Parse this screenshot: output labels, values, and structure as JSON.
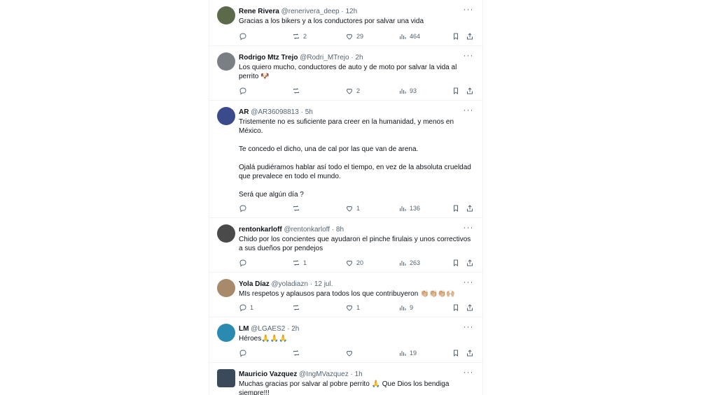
{
  "tweets": [
    {
      "name": "Rene Rivera",
      "handle": "@renerivera_deep",
      "time": "12h",
      "text": "Gracias a los bikers y a los conductores por salvar una vida",
      "replies": "",
      "retweets": "2",
      "likes": "29",
      "views": "464",
      "avatar_color": "#5a6a4a"
    },
    {
      "name": "Rodrigo Mtz Trejo",
      "handle": "@Rodri_MTrejo",
      "time": "2h",
      "text": "Los quiero mucho, conductores de auto y de moto por salvar la vida al perrito 🐶",
      "replies": "",
      "retweets": "",
      "likes": "2",
      "views": "93",
      "avatar_color": "#7a7f86"
    },
    {
      "name": "AR",
      "handle": "@AR36098813",
      "time": "5h",
      "text": "Tristemente no es suficiente para creer en la humanidad, y menos en México.\n\nTe concedo el dicho, una de cal por las que van de arena.\n\nOjalá pudiéramos hablar así todo el tiempo, en vez de la absoluta crueldad que prevalece en todo el mundo.\n\nSerá que algún día ?",
      "replies": "",
      "retweets": "",
      "likes": "1",
      "views": "136",
      "avatar_color": "#3b4a8a"
    },
    {
      "name": "rentonkarloff",
      "handle": "@rentonkarloff",
      "time": "8h",
      "text": "Chido por los concientes que ayudaron el pinche firulais y unos correctivos a sus dueños por pendejos",
      "replies": "",
      "retweets": "1",
      "likes": "20",
      "views": "263",
      "avatar_color": "#4a4a4a"
    },
    {
      "name": "Yola Díaz",
      "handle": "@yoladiazn",
      "time": "12 jul.",
      "text": "MIs respetos y aplausos para todos los que contribuyeron 👏🏼👏🏼👏🏼🙌🏼",
      "replies": "1",
      "retweets": "",
      "likes": "1",
      "views": "9",
      "avatar_color": "#a88a6a"
    },
    {
      "name": "LM",
      "handle": "@LGAES2",
      "time": "2h",
      "text": "Héroes🙏🙏🙏",
      "replies": "",
      "retweets": "",
      "likes": "",
      "views": "19",
      "avatar_color": "#2a8ab0"
    },
    {
      "name": "Mauricio Vazquez",
      "handle": "@IngMVazquez",
      "time": "1h",
      "text": "Muchas gracias por salvar al pobre perrito 🙏 Que Dios los bendiga siempre!!!",
      "replies": "",
      "retweets": "",
      "likes": "",
      "views": "",
      "avatar_color": "#3a4a5a"
    }
  ],
  "separator": "·",
  "more_glyph": "···"
}
